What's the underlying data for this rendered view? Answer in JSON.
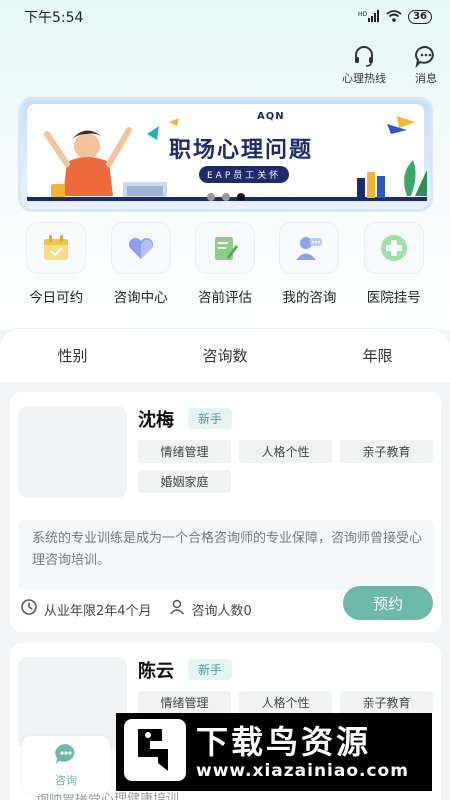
{
  "status_bar": {
    "time": "下午5:54",
    "signal": "HD",
    "battery": "36"
  },
  "header": {
    "hotline_label": "心理热线",
    "message_label": "消息"
  },
  "banner": {
    "sub": "AQN",
    "title": "职场心理问题",
    "tag": "EAP员工关怀",
    "dots": 3,
    "active_dot": 3
  },
  "quick_actions": [
    {
      "label": "今日可约",
      "icon": "calendar-check-icon"
    },
    {
      "label": "咨询中心",
      "icon": "heart-icon"
    },
    {
      "label": "咨前评估",
      "icon": "clipboard-edit-icon"
    },
    {
      "label": "我的咨询",
      "icon": "user-chat-icon"
    },
    {
      "label": "医院挂号",
      "icon": "medical-cross-icon"
    }
  ],
  "filters": [
    "性别",
    "咨询数",
    "年限"
  ],
  "counselors": [
    {
      "name": "沈梅",
      "badge": "新手",
      "tags": [
        "情绪管理",
        "人格个性",
        "亲子教育",
        "婚姻家庭"
      ],
      "description": "系统的专业训练是成为一个合格咨询师的专业保障，咨询师曾接受心理咨询培训。",
      "experience": "从业年限2年4个月",
      "consult_count": "咨询人数0",
      "book_label": "预约"
    },
    {
      "name": "陈云",
      "badge": "新手",
      "tags": [
        "情绪管理",
        "人格个性",
        "亲子教育"
      ],
      "description": "询师曾接受心理健康培训",
      "experience": "",
      "consult_count": "",
      "book_label": ""
    }
  ],
  "tabbar": {
    "active_label": "咨询"
  },
  "watermark": {
    "title": "下载鸟资源",
    "url": "www.xiazainiao.com"
  },
  "colors": {
    "accent": "#6db8a8",
    "banner_title": "#1d2a6e"
  }
}
